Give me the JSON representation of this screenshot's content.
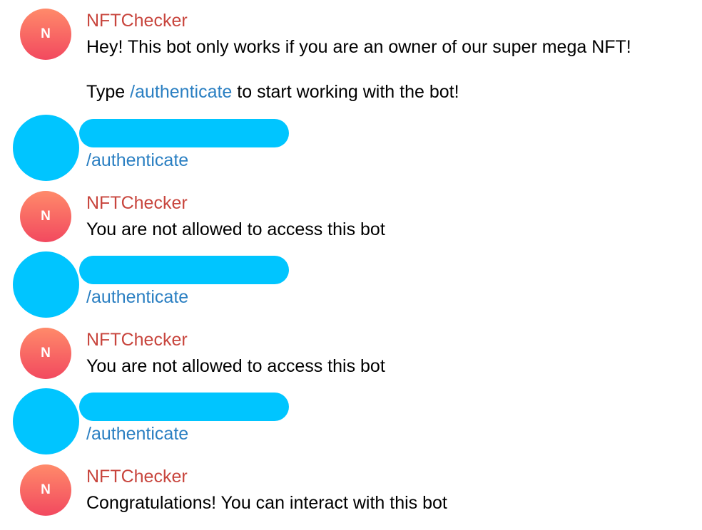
{
  "bot": {
    "name": "NFTChecker",
    "avatar_initial": "N",
    "avatar_colors": [
      "#ff8a6a",
      "#f2495f"
    ],
    "name_color": "#c8453d"
  },
  "link_color": "#2a7fc2",
  "user_avatar_color": "#00c5ff",
  "messages": [
    {
      "sender": "NFTChecker",
      "line1": "Hey! This bot only works if you are an owner of our super mega NFT!",
      "line2_prefix": "Type ",
      "line2_command": "/authenticate",
      "line2_suffix": " to start working with the bot!"
    },
    {
      "text": "/authenticate"
    },
    {
      "sender": "NFTChecker",
      "text": "You are not allowed to access this bot"
    },
    {
      "text": "/authenticate"
    },
    {
      "sender": "NFTChecker",
      "text": "You are not allowed to access this bot"
    },
    {
      "text": "/authenticate"
    },
    {
      "sender": "NFTChecker",
      "text": "Congratulations! You can interact with this bot"
    }
  ]
}
